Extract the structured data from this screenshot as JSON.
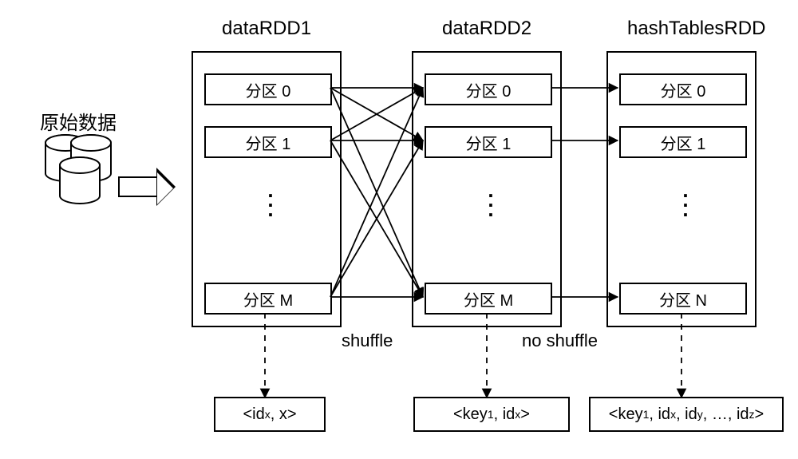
{
  "source_label": "原始数据",
  "columns": {
    "c1": {
      "title": "dataRDD1",
      "parts": [
        "分区 0",
        "分区 1",
        "分区 M"
      ]
    },
    "c2": {
      "title": "dataRDD2",
      "parts": [
        "分区 0",
        "分区 1",
        "分区 M"
      ]
    },
    "c3": {
      "title": "hashTablesRDD",
      "parts": [
        "分区 0",
        "分区 1",
        "分区 N"
      ]
    }
  },
  "ops": {
    "o1": "shuffle",
    "o2": "no shuffle"
  },
  "databoxes": {
    "d1_pre": "<id",
    "d1_sub": "x",
    "d1_post": ", x>",
    "d2_pre": "<key",
    "d2_s1": "1",
    "d2_mid": ", id",
    "d2_s2": "x",
    "d2_post": ">",
    "d3_pre": "<key",
    "d3_s1": "1",
    "d3_m1": ", id",
    "d3_s2": "x",
    "d3_m2": ", id",
    "d3_s3": "y",
    "d3_m3": ", …, id",
    "d3_s4": "z",
    "d3_post": ">"
  }
}
